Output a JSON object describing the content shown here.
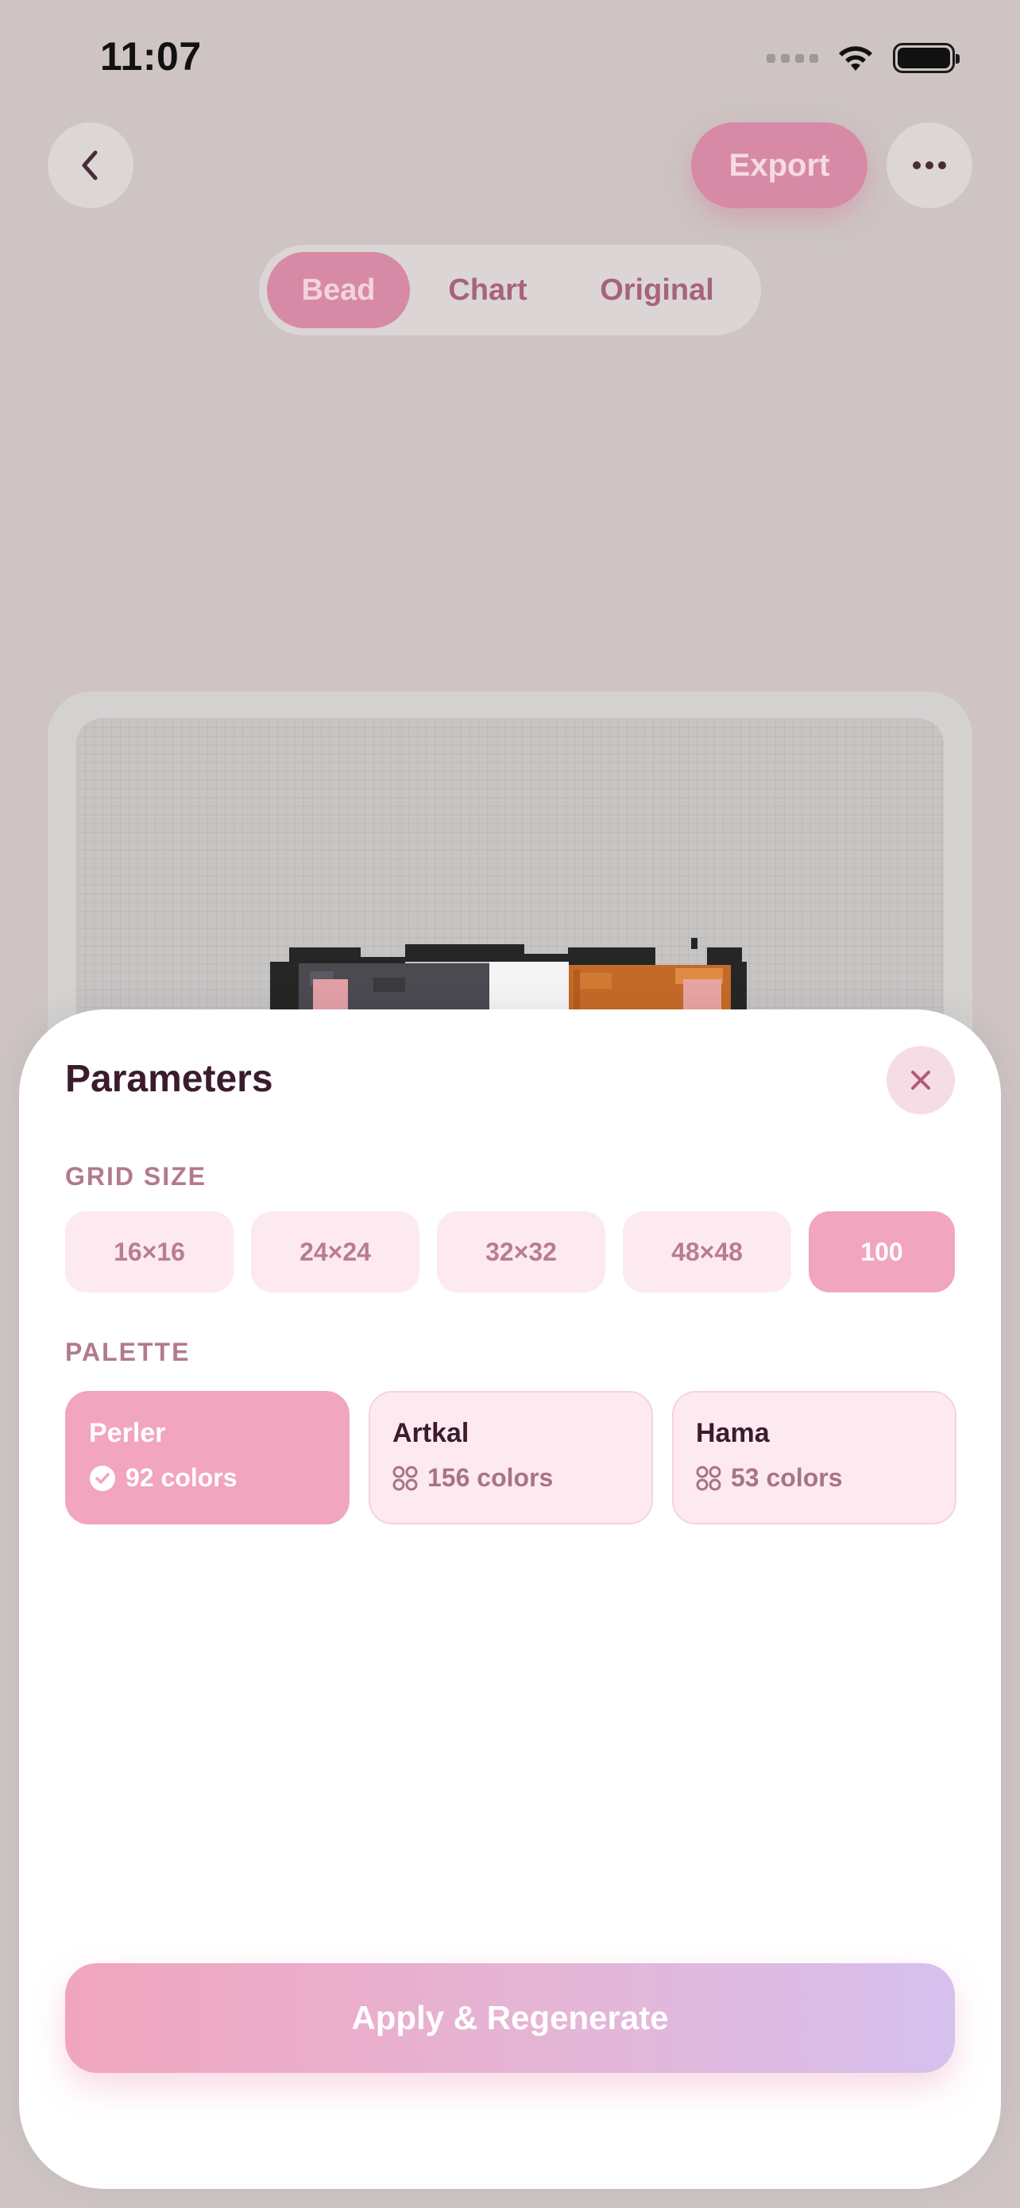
{
  "status_bar": {
    "time": "11:07"
  },
  "nav": {
    "export_label": "Export",
    "back_icon": "chevron-left-icon",
    "more_icon": "ellipsis-icon"
  },
  "view_tabs": {
    "items": [
      {
        "label": "Bead",
        "selected": true
      },
      {
        "label": "Chart",
        "selected": false
      },
      {
        "label": "Original",
        "selected": false
      }
    ]
  },
  "parameters": {
    "title": "Parameters",
    "grid_size": {
      "label": "GRID SIZE",
      "options": [
        "16×16",
        "24×24",
        "32×32",
        "48×48",
        "100"
      ],
      "selected": "100"
    },
    "palette": {
      "label": "PALETTE",
      "options": [
        {
          "name": "Perler",
          "meta": "92 colors",
          "selected": true
        },
        {
          "name": "Artkal",
          "meta": "156 colors",
          "selected": false
        },
        {
          "name": "Hama",
          "meta": "53 colors",
          "selected": false
        }
      ]
    },
    "apply_label": "Apply & Regenerate"
  },
  "colors": {
    "accent_pink": "#f2a5bf",
    "accent_lavender": "#d6c1ef",
    "title_text": "#3b1c2c",
    "muted_label": "#b27a8f",
    "overlay_bg": "#cdc4c3"
  }
}
